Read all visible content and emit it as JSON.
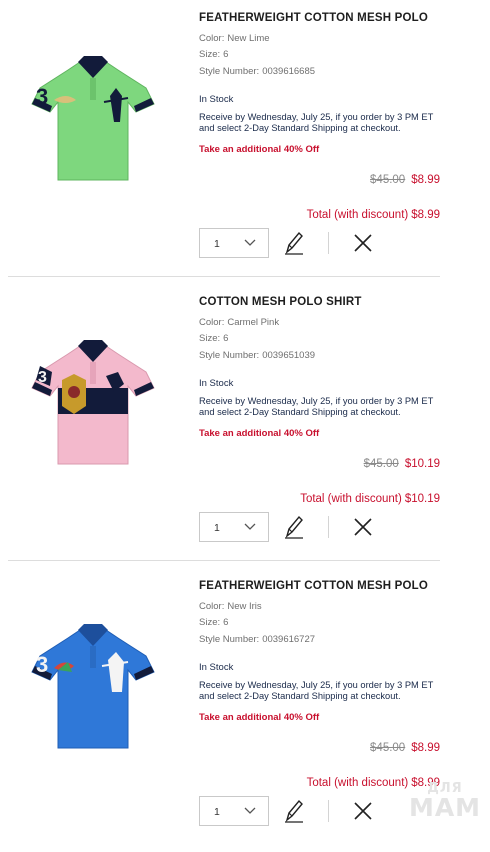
{
  "labels": {
    "color": "Color:",
    "size": "Size:",
    "style": "Style Number:",
    "total": "Total (with discount)"
  },
  "items": [
    {
      "name": "FEATHERWEIGHT COTTON MESH POLO",
      "color": "New Lime",
      "size": "6",
      "style_number": "0039616685",
      "stock": "In Stock",
      "delivery": "Receive by Wednesday, July 25, if you order by 3 PM ET and select 2-Day Standard Shipping at checkout.",
      "promo": "Take an additional 40% Off",
      "original_price": "$45.00",
      "sale_price": "$8.99",
      "total": "$8.99",
      "quantity": "1",
      "shirt_color": "#7ed77e",
      "image_icon": "polo-shirt-green-icon"
    },
    {
      "name": "COTTON MESH POLO SHIRT",
      "color": "Carmel Pink",
      "size": "6",
      "style_number": "0039651039",
      "stock": "In Stock",
      "delivery": "Receive by Wednesday, July 25, if you order by 3 PM ET and select 2-Day Standard Shipping at checkout.",
      "promo": "Take an additional 40% Off",
      "original_price": "$45.00",
      "sale_price": "$10.19",
      "total": "$10.19",
      "quantity": "1",
      "shirt_color": "#f3b9cc",
      "image_icon": "polo-shirt-pink-icon"
    },
    {
      "name": "FEATHERWEIGHT COTTON MESH POLO",
      "color": "New Iris",
      "size": "6",
      "style_number": "0039616727",
      "stock": "In Stock",
      "delivery": "Receive by Wednesday, July 25, if you order by 3 PM ET and select 2-Day Standard Shipping at checkout.",
      "promo": "Take an additional 40% Off",
      "original_price": "$45.00",
      "sale_price": "$8.99",
      "total": "$8.99",
      "quantity": "1",
      "shirt_color": "#2f78d8",
      "image_icon": "polo-shirt-blue-icon"
    }
  ],
  "icons": {
    "edit": "pencil-icon",
    "remove": "close-icon",
    "dropdown": "chevron-down-icon"
  },
  "colors": {
    "accent_red": "#c8102e",
    "navy": "#1a2a4a"
  },
  "watermark": {
    "line1": "ДЛЯ",
    "line2": "МАМ"
  }
}
